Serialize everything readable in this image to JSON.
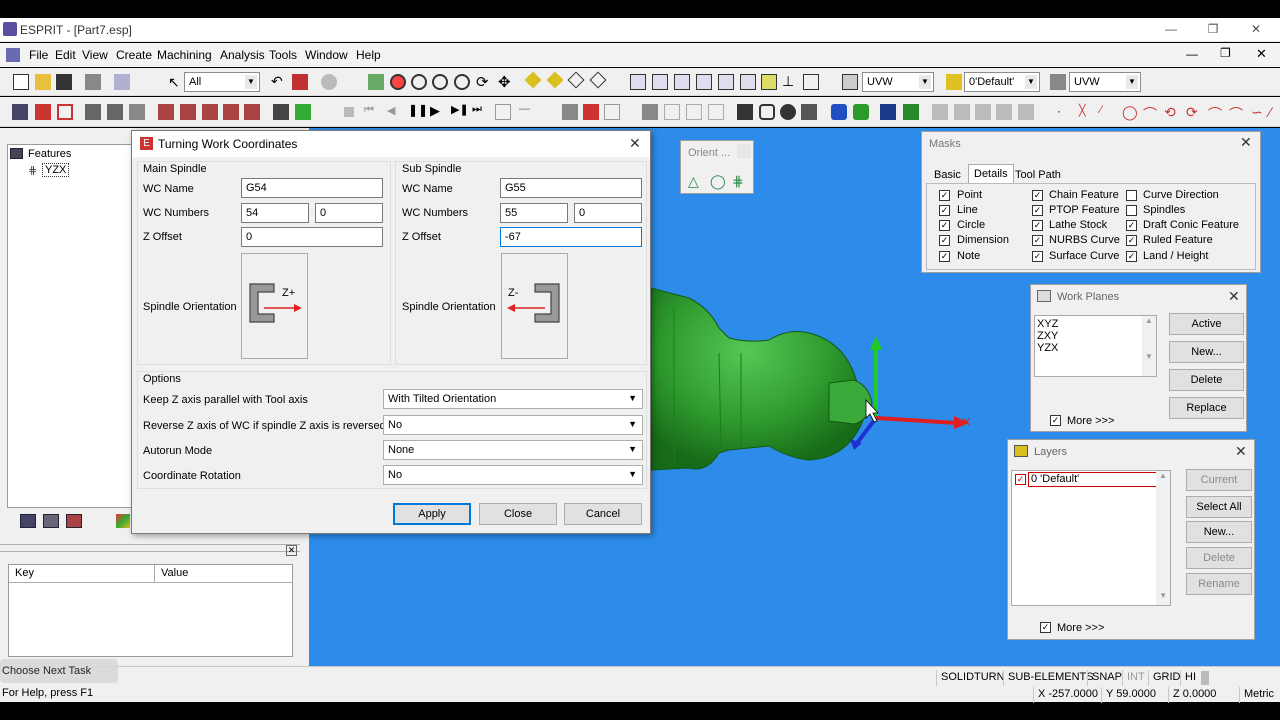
{
  "app": {
    "title": "ESPRIT - [Part7.esp]"
  },
  "menu": [
    "File",
    "Edit",
    "View",
    "Create",
    "Machining",
    "Analysis",
    "Tools",
    "Window",
    "Help"
  ],
  "toolbar": {
    "filter_value": "All",
    "uvw1": "UVW",
    "layer": "0'Default'",
    "uvw2": "UVW"
  },
  "features": {
    "title": "Features",
    "item": "YZX"
  },
  "props": {
    "col_key": "Key",
    "col_value": "Value"
  },
  "task": {
    "label": "Choose Next Task"
  },
  "dialog": {
    "title": "Turning Work Coordinates",
    "main": {
      "header": "Main Spindle",
      "wc_name_label": "WC Name",
      "wc_name": "G54",
      "wc_numbers_label": "WC Numbers",
      "wc_num1": "54",
      "wc_num2": "0",
      "z_offset_label": "Z Offset",
      "z_offset": "0",
      "orientation_label": "Spindle Orientation",
      "orientation_axis": "Z+"
    },
    "sub": {
      "header": "Sub Spindle",
      "wc_name_label": "WC Name",
      "wc_name": "G55",
      "wc_numbers_label": "WC Numbers",
      "wc_num1": "55",
      "wc_num2": "0",
      "z_offset_label": "Z Offset",
      "z_offset": "-67",
      "orientation_label": "Spindle Orientation",
      "orientation_axis": "Z-"
    },
    "options": {
      "header": "Options",
      "rows": [
        {
          "label": "Keep Z axis parallel with Tool axis",
          "value": "With Tilted Orientation"
        },
        {
          "label": "Reverse Z axis of WC if spindle Z axis is reversed",
          "value": "No"
        },
        {
          "label": "Autorun Mode",
          "value": "None"
        },
        {
          "label": "Coordinate Rotation",
          "value": "No"
        }
      ]
    },
    "buttons": {
      "apply": "Apply",
      "close": "Close",
      "cancel": "Cancel"
    }
  },
  "orient": {
    "title": "Orient ..."
  },
  "masks": {
    "title": "Masks",
    "tabs": [
      "Basic",
      "Details",
      "Tool Path"
    ],
    "col1": [
      "Point",
      "Line",
      "Circle",
      "Dimension",
      "Note"
    ],
    "col2": [
      "Chain Feature",
      "PTOP Feature",
      "Lathe Stock",
      "NURBS Curve",
      "Surface Curve"
    ],
    "col3": [
      "Curve Direction",
      "Spindles",
      "Draft Conic Feature",
      "Ruled Feature",
      "Land / Height"
    ]
  },
  "work_planes": {
    "title": "Work Planes",
    "list": [
      "XYZ",
      "ZXY",
      "YZX"
    ],
    "buttons": [
      "Active",
      "New...",
      "Delete",
      "Replace"
    ],
    "more": "More >>>"
  },
  "layers": {
    "title": "Layers",
    "item": "0 'Default'",
    "buttons": [
      "Current",
      "Select All",
      "New...",
      "Delete",
      "Rename"
    ],
    "more": "More >>>"
  },
  "status": {
    "help": "For Help, press F1",
    "modes": [
      "SOLIDTURN",
      "SUB-ELEMENTS",
      "SNAP",
      "INT",
      "GRID",
      "HI"
    ],
    "x": "X -257.0000",
    "y": "Y 59.0000",
    "z": "Z 0.0000",
    "units": "Metric"
  },
  "colors": {
    "viewport": "#2d8cea",
    "part": "#2e9a2e",
    "accent": "#0078d7"
  }
}
